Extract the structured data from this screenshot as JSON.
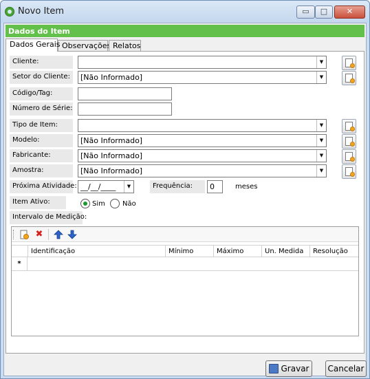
{
  "window": {
    "title": "Novo Item",
    "controls": {
      "minimize": "▭",
      "maximize": "□",
      "close": "✕"
    }
  },
  "header": {
    "title": "Dados do Item"
  },
  "tabs": [
    {
      "label": "Dados Gerais",
      "active": true
    },
    {
      "label": "Observações",
      "active": false
    },
    {
      "label": "Relatos",
      "active": false
    }
  ],
  "form": {
    "cliente": {
      "label": "Cliente:",
      "value": ""
    },
    "setor": {
      "label": "Setor do Cliente:",
      "value": "[Não Informado]"
    },
    "codigo": {
      "label": "Código/Tag:",
      "value": ""
    },
    "serie": {
      "label": "Número de Série:",
      "value": ""
    },
    "tipo": {
      "label": "Tipo de Item:",
      "value": ""
    },
    "modelo": {
      "label": "Modelo:",
      "value": "[Não Informado]"
    },
    "fabricante": {
      "label": "Fabricante:",
      "value": "[Não Informado]"
    },
    "amostra": {
      "label": "Amostra:",
      "value": "[Não Informado]"
    },
    "proxima_atividade": {
      "label": "Próxima Atividade:",
      "value": "__/__/____"
    },
    "frequencia": {
      "label": "Frequência:",
      "value": "0",
      "unit": "meses"
    },
    "item_ativo": {
      "label": "Item Ativo:",
      "options": [
        "Sim",
        "Não"
      ],
      "selected": "Sim"
    },
    "intervalo_label": "Intervalo de Medição:"
  },
  "grid": {
    "columns": [
      "Identificação",
      "Mínimo",
      "Máximo",
      "Un. Medida",
      "Resolução"
    ],
    "new_row_marker": "*",
    "toolbar_icons": [
      "new-icon",
      "delete-icon",
      "move-up-icon",
      "move-down-icon"
    ]
  },
  "buttons": {
    "save": "Gravar",
    "cancel": "Cancelar"
  },
  "colors": {
    "header": "#63c14b",
    "window_frame": "#c9dcf1",
    "delete": "#d8201a",
    "arrows": "#2a63c9"
  }
}
